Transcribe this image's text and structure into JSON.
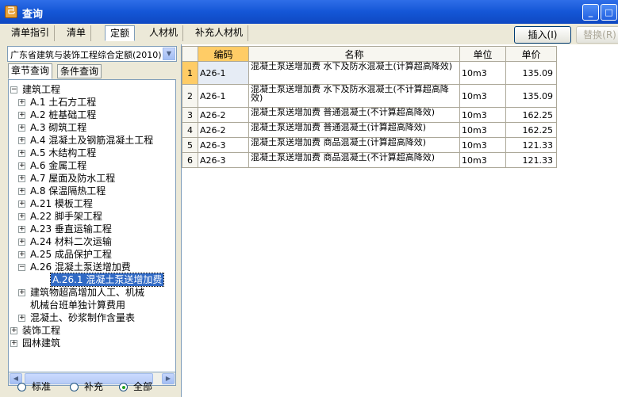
{
  "window": {
    "title": "查询",
    "icon_glyph": "己",
    "minimize_glyph": "_",
    "maximize_glyph": "□"
  },
  "tabs": [
    {
      "label": "清单指引"
    },
    {
      "label": "清单"
    },
    {
      "label": "定额"
    },
    {
      "label": "人材机"
    },
    {
      "label": "补充人材机"
    }
  ],
  "toolbar": {
    "insert_label": "插入(I)",
    "replace_label": "替换(R)"
  },
  "left": {
    "dataset": "广东省建筑与装饰工程综合定额(2010)",
    "subtabs": [
      {
        "label": "章节查询"
      },
      {
        "label": "条件查询"
      }
    ],
    "tree": [
      {
        "label": "建筑工程",
        "level": 0,
        "sign": "−"
      },
      {
        "label": "A.1 土石方工程",
        "level": 1,
        "sign": "+"
      },
      {
        "label": "A.2 桩基础工程",
        "level": 1,
        "sign": "+"
      },
      {
        "label": "A.3 砌筑工程",
        "level": 1,
        "sign": "+"
      },
      {
        "label": "A.4 混凝土及钢筋混凝土工程",
        "level": 1,
        "sign": "+"
      },
      {
        "label": "A.5 木结构工程",
        "level": 1,
        "sign": "+"
      },
      {
        "label": "A.6 金属工程",
        "level": 1,
        "sign": "+"
      },
      {
        "label": "A.7 屋面及防水工程",
        "level": 1,
        "sign": "+"
      },
      {
        "label": "A.8 保温隔热工程",
        "level": 1,
        "sign": "+"
      },
      {
        "label": "A.21 模板工程",
        "level": 1,
        "sign": "+"
      },
      {
        "label": "A.22 脚手架工程",
        "level": 1,
        "sign": "+"
      },
      {
        "label": "A.23 垂直运输工程",
        "level": 1,
        "sign": "+"
      },
      {
        "label": "A.24 材料二次运输",
        "level": 1,
        "sign": "+"
      },
      {
        "label": "A.25 成品保护工程",
        "level": 1,
        "sign": "+"
      },
      {
        "label": "A.26 混凝土泵送增加费",
        "level": 1,
        "sign": "−"
      },
      {
        "label": "A.26.1 混凝土泵送增加费",
        "level": 2,
        "sign": "",
        "selected": true
      },
      {
        "label": "建筑物超高增加人工、机械",
        "level": 1,
        "sign": "+"
      },
      {
        "label": "机械台班单独计算费用",
        "level": 1,
        "sign": ""
      },
      {
        "label": "混凝土、砂浆制作含量表",
        "level": 1,
        "sign": "+"
      },
      {
        "label": "装饰工程",
        "level": 0,
        "sign": "+"
      },
      {
        "label": "园林建筑",
        "level": 0,
        "sign": "+"
      }
    ],
    "scroll_left": "◀",
    "scroll_right": "▶",
    "filters": [
      {
        "label": "标准",
        "checked": false
      },
      {
        "label": "补充",
        "checked": false
      },
      {
        "label": "全部",
        "checked": true
      }
    ]
  },
  "grid": {
    "columns": {
      "code": "编码",
      "name": "名称",
      "unit": "单位",
      "price": "单价"
    },
    "rows": [
      {
        "n": "1",
        "code": "A26-1",
        "name": "混凝土泵送增加费 水下及防水混凝土(计算超高降效)",
        "unit": "10m3",
        "price": "135.09"
      },
      {
        "n": "2",
        "code": "A26-1",
        "name": "混凝土泵送增加费 水下及防水混凝土(不计算超高降效)",
        "unit": "10m3",
        "price": "135.09"
      },
      {
        "n": "3",
        "code": "A26-2",
        "name": "混凝土泵送增加费 普通混凝土(不计算超高降效)",
        "unit": "10m3",
        "price": "162.25"
      },
      {
        "n": "4",
        "code": "A26-2",
        "name": "混凝土泵送增加费 普通混凝土(计算超高降效)",
        "unit": "10m3",
        "price": "162.25"
      },
      {
        "n": "5",
        "code": "A26-3",
        "name": "混凝土泵送增加费 商品混凝土(计算超高降效)",
        "unit": "10m3",
        "price": "121.33"
      },
      {
        "n": "6",
        "code": "A26-3",
        "name": "混凝土泵送增加费 商品混凝土(不计算超高降效)",
        "unit": "10m3",
        "price": "121.33"
      }
    ]
  }
}
